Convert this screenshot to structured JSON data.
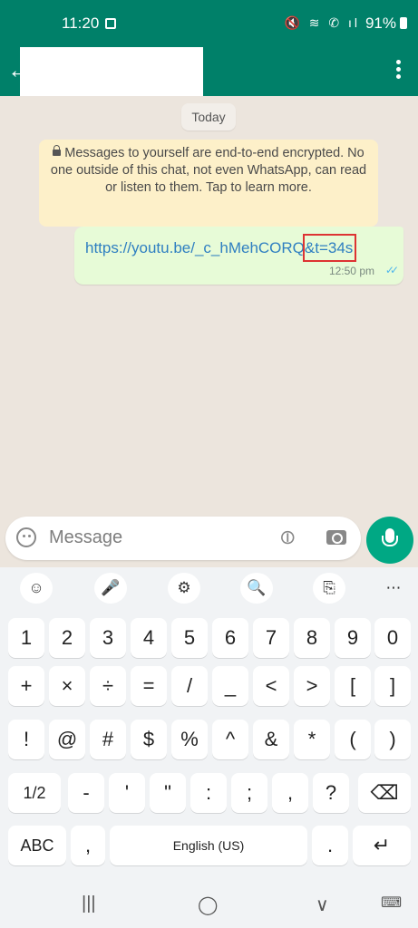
{
  "status_bar": {
    "time": "11:20",
    "battery": "91%",
    "icons": [
      "image-icon",
      "mute-icon",
      "wifi-icon",
      "call-icon",
      "signal-icon",
      "battery-icon"
    ]
  },
  "app_bar": {
    "title": "",
    "back_icon": "←",
    "menu_icon": "more-vertical-icon"
  },
  "chat": {
    "date_chip": "Today",
    "encryption_notice": "Messages to yourself are end-to-end encrypted. No one outside of this chat, not even WhatsApp, can read or listen to them. Tap to learn more.",
    "messages": [
      {
        "link_main": "https://youtu.be/_c_hMehCORQ",
        "link_highlight": "&t=34s",
        "time": "12:50 pm",
        "ticks": "✓✓",
        "direction": "outgoing"
      }
    ]
  },
  "composer": {
    "placeholder": "Message"
  },
  "keyboard": {
    "toolbar": [
      "☺",
      "🎤",
      "⚙",
      "🔍",
      "⎘",
      "⋯"
    ],
    "row1": [
      "1",
      "2",
      "3",
      "4",
      "5",
      "6",
      "7",
      "8",
      "9",
      "0"
    ],
    "row2": [
      "+",
      "×",
      "÷",
      "=",
      "/",
      "_",
      "<",
      ">",
      "[",
      "]"
    ],
    "row3": [
      "!",
      "@",
      "#",
      "$",
      "%",
      "^",
      "&",
      "*",
      "(",
      ")"
    ],
    "row4": [
      "1/2",
      "-",
      "'",
      "\"",
      ":",
      ";",
      ",",
      "?",
      "⌫"
    ],
    "row5": {
      "abc": "ABC",
      "comma": ",",
      "space": "English (US)",
      "period": ".",
      "enter": "↵"
    }
  },
  "nav_bar": {
    "recents": "|||",
    "home": "◯",
    "back": "∨",
    "keyboard": "⌨"
  },
  "colors": {
    "header": "#008069",
    "accent": "#00a884",
    "bubble_out": "#e7fbd7",
    "encryption_bg": "#fdf0c9",
    "link": "#2f7fc1",
    "highlight_box": "#dd3333"
  }
}
